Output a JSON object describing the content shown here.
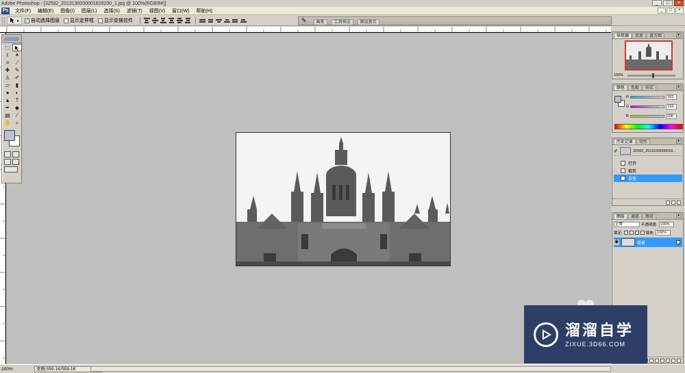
{
  "window": {
    "title": "Adobe Photoshop - [32592_2013130000001828200_1.jpg @ 100%(RGB/8#)]",
    "min": "_",
    "max": "□",
    "close": "×"
  },
  "menu": [
    "文件(F)",
    "编辑(E)",
    "图像(I)",
    "图层(L)",
    "选择(S)",
    "滤镜(T)",
    "视图(V)",
    "窗口(W)",
    "帮助(H)"
  ],
  "doc_buttons": {
    "min": "_",
    "restore": "□",
    "close": "×"
  },
  "options": {
    "tool_arrow": "▸",
    "auto_select_layer": "自动选择图层",
    "show_bounding_box": "显示定界框",
    "show_transform_controls": "显示变换控件"
  },
  "palette_well": {
    "tabs": [
      "画笔",
      "工具预设",
      "图层复合"
    ]
  },
  "navigator": {
    "tabs": [
      "导航器",
      "信息",
      "直方图"
    ],
    "zoom": "100%"
  },
  "color": {
    "tabs": [
      "颜色",
      "色板",
      "样式"
    ],
    "channels": [
      {
        "label": "R",
        "value": "183",
        "gradient": "linear-gradient(90deg,#00c1d0,#ffc1d0)"
      },
      {
        "label": "G",
        "value": "193",
        "gradient": "linear-gradient(90deg,#b700d0,#b7ffd0)"
      },
      {
        "label": "B",
        "value": "208",
        "gradient": "linear-gradient(90deg,#b7c100,#b7c1ff)"
      }
    ]
  },
  "history": {
    "tabs": [
      "历史记录",
      "动作"
    ],
    "snapshot": "32592_2013130000018...",
    "items": [
      {
        "label": "打开",
        "selected": false
      },
      {
        "label": "裁剪",
        "selected": false
      },
      {
        "label": "去色",
        "selected": true
      }
    ]
  },
  "layers": {
    "tabs": [
      "图层",
      "通道",
      "路径"
    ],
    "blend_mode": "正常",
    "opacity_label": "不透明度:",
    "opacity": "100%",
    "lock_label": "锁定:",
    "fill_label": "填充:",
    "fill": "100%",
    "layer_name": "背景"
  },
  "status": {
    "zoom": "100%",
    "doc_info": "文档:559.1K/559.1K"
  },
  "watermark": {
    "brand": "溜溜自学",
    "url": "ZIXUE.3D66.COM"
  }
}
